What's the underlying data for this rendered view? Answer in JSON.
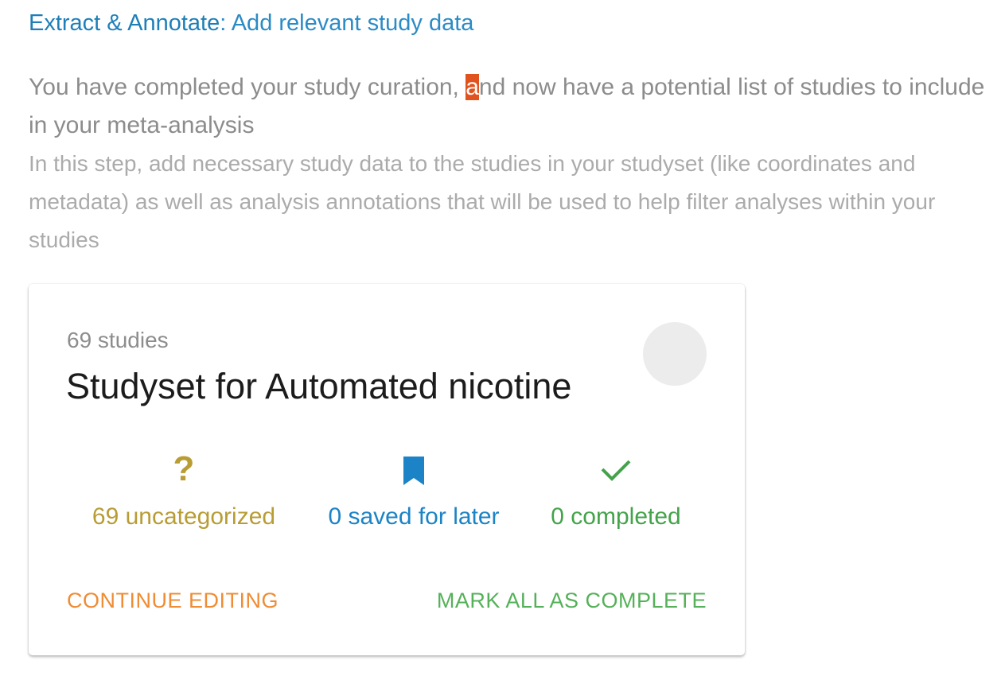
{
  "header": {
    "title": "Extract & Annotate",
    "separator": ": ",
    "subtitle": "Add relevant study data"
  },
  "lead": {
    "before": "You have completed your study curation, ",
    "highlight": "a",
    "after": "nd now have a potential list of studies to include in your meta-analysis"
  },
  "description": "In this step, add necessary study data to the studies in your studyset (like coordinates and metadata) as well as analysis annotations that will be used to help filter analyses within your studies",
  "card": {
    "count": "69 studies",
    "title": "Studyset for Automated nicotine",
    "stats": {
      "uncategorized": {
        "label": "69 uncategorized",
        "icon": "question-mark-icon",
        "color": "#b89c34"
      },
      "saved": {
        "label": "0 saved for later",
        "icon": "bookmark-icon",
        "color": "#1b83c6"
      },
      "completed": {
        "label": "0 completed",
        "icon": "checkmark-icon",
        "color": "#43a34a"
      }
    },
    "actions": {
      "continue": "CONTINUE EDITING",
      "complete": "MARK ALL AS COMPLETE"
    }
  },
  "colors": {
    "header": "#1e7fb8",
    "highlight": "#e0531f",
    "continue": "#ef8c34",
    "complete": "#55b159"
  }
}
